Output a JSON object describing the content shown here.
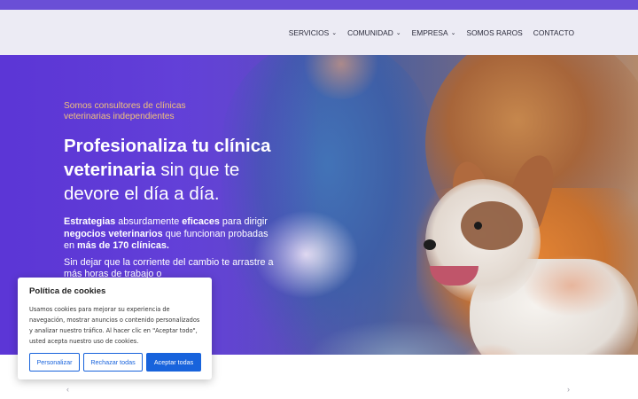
{
  "nav": {
    "items": [
      {
        "label": "SERVICIOS",
        "has_dropdown": true
      },
      {
        "label": "COMUNIDAD",
        "has_dropdown": true
      },
      {
        "label": "EMPRESA",
        "has_dropdown": true
      },
      {
        "label": "SOMOS RAROS",
        "has_dropdown": false
      },
      {
        "label": "CONTACTO",
        "has_dropdown": false
      }
    ],
    "chevron": "⌄"
  },
  "hero": {
    "eyebrow": "Somos consultores de clínicas veterinarias independientes",
    "headline_bold": "Profesionaliza tu clínica veterinaria",
    "headline_rest": " sin que te devore el día a día.",
    "p1": {
      "a": "Estrategias",
      "b": " absurdamente ",
      "c": "eficaces",
      "d": " para dirigir ",
      "e": "negocios veterinarios",
      "f": " que funcionan probadas en ",
      "g": "más de 170 clínicas."
    },
    "p2": "Sin dejar que la corriente del cambio te arrastre a más horas de trabajo o"
  },
  "cookie": {
    "title": "Política de cookies",
    "text": "Usamos cookies para mejorar su experiencia de navegación, mostrar anuncios o contenido personalizados y analizar nuestro tráfico. Al hacer clic en \"Aceptar todo\", usted acepta nuestro uso de cookies.",
    "customize": "Personalizar",
    "reject": "Rechazar todas",
    "accept": "Aceptar todas"
  },
  "carousel": {
    "prev": "‹",
    "next": "›"
  },
  "colors": {
    "accent": "#1863dc",
    "hero_purple": "#5b35d6",
    "eyebrow": "#f2c27a"
  }
}
